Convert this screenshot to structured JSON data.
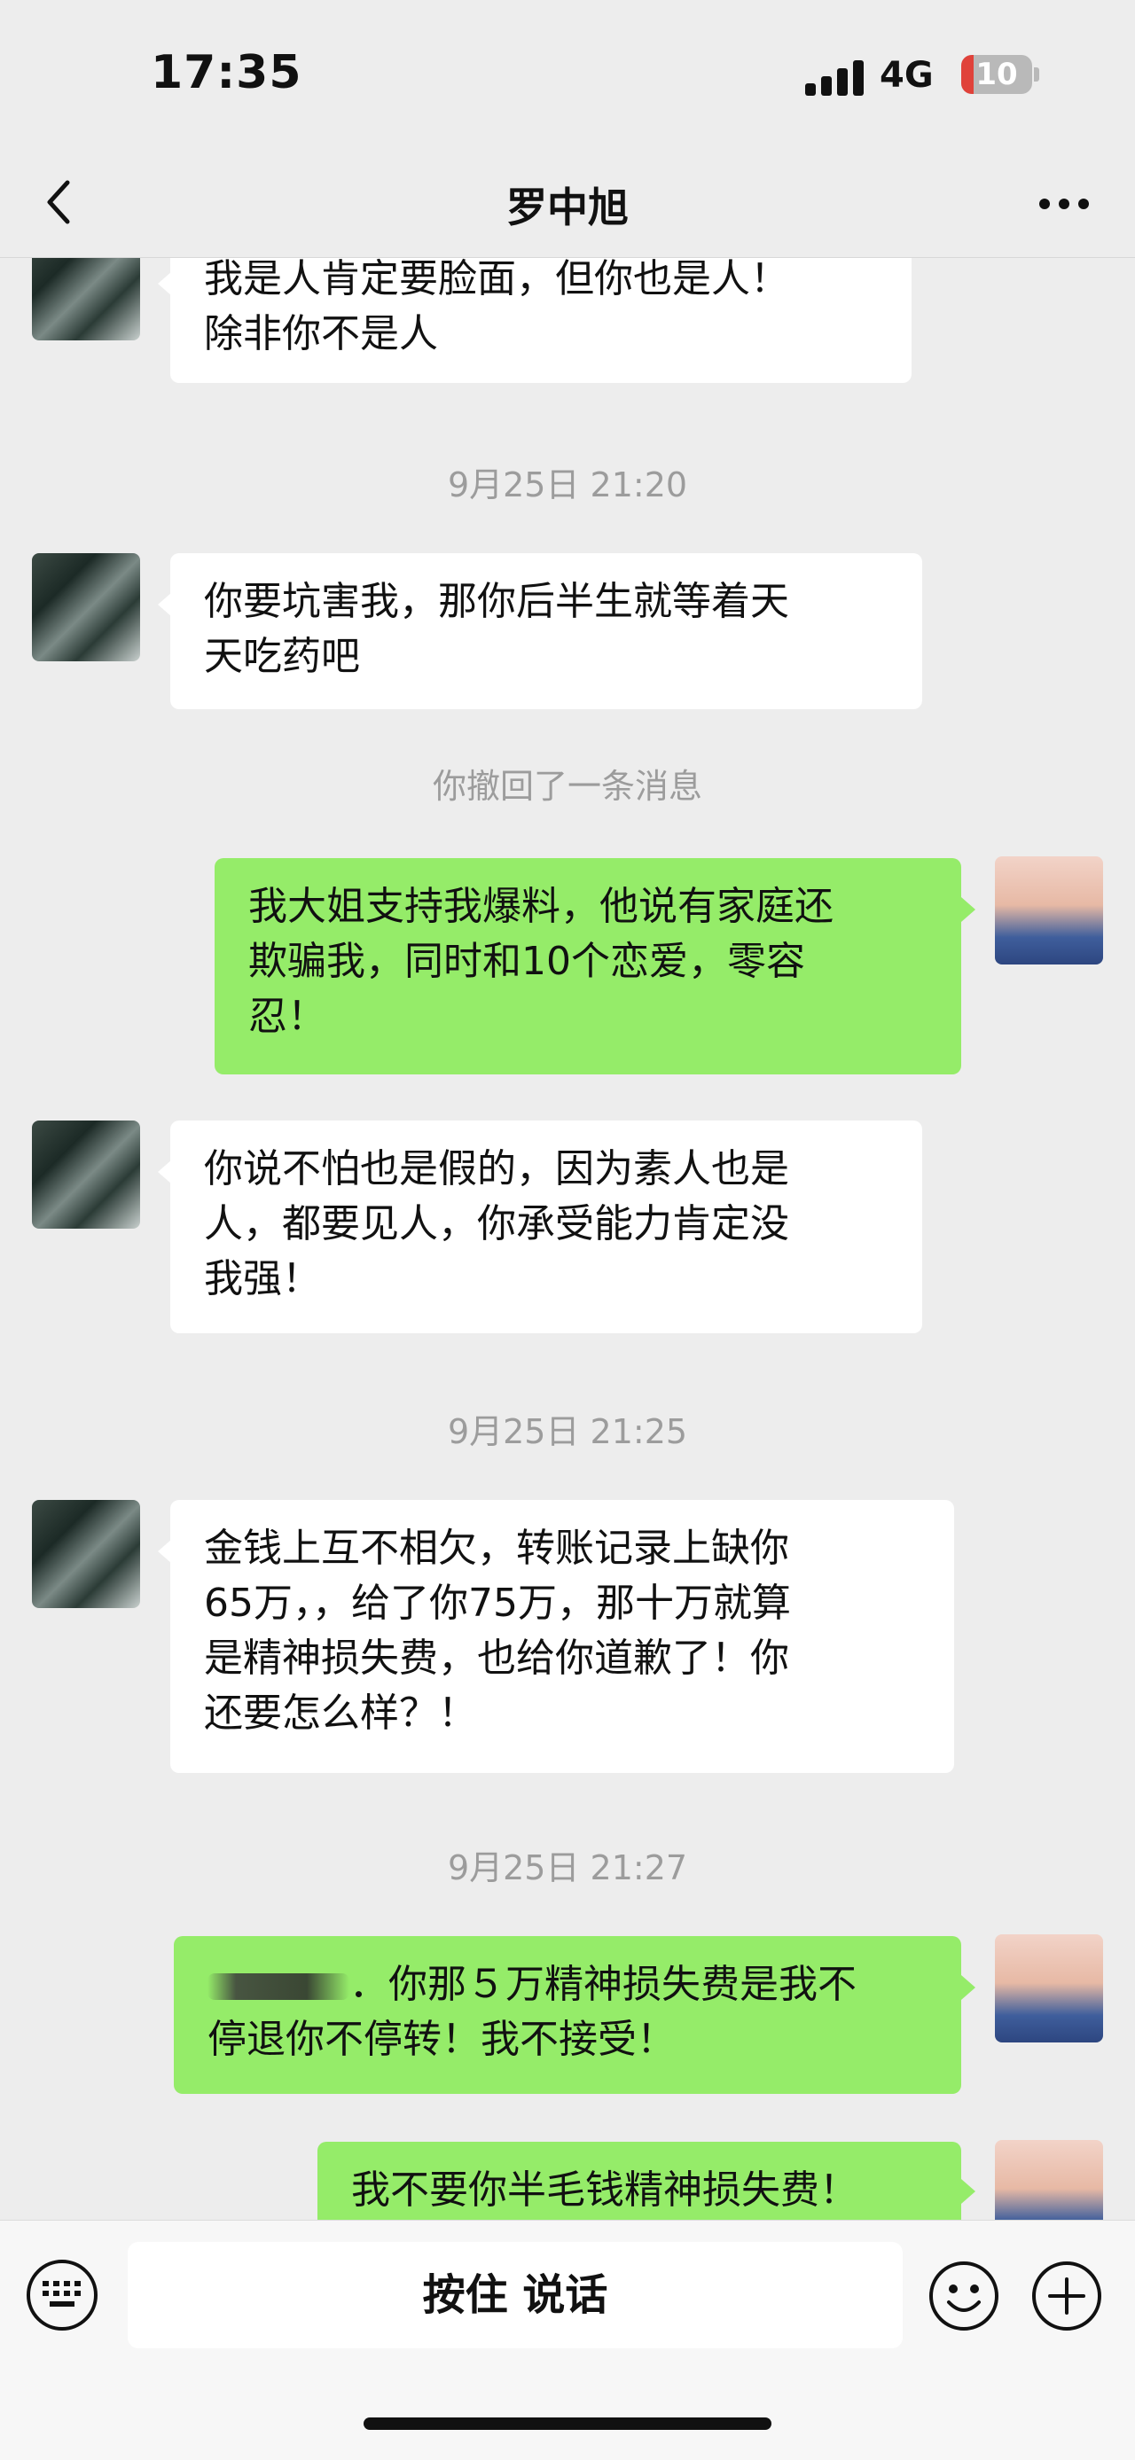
{
  "status_bar": {
    "time": "17:35",
    "network": "4G",
    "battery": "10"
  },
  "header": {
    "title": "罗中旭"
  },
  "messages": {
    "m1": {
      "line1": "我是人肯定要脸面，但你也是人！",
      "line2": "除非你不是人"
    },
    "t1": "9月25日 21:20",
    "m2": {
      "line1": "你要坑害我，那你后半生就等着天",
      "line2": "天吃药吧"
    },
    "recall": "你撤回了一条消息",
    "m3": {
      "line1": "我大姐支持我爆料，他说有家庭还",
      "line2": "欺骗我，同时和10个恋爱，零容",
      "line3": "忍！"
    },
    "m4": {
      "line1": "你说不怕也是假的，因为素人也是",
      "line2": "人，都要见人，你承受能力肯定没",
      "line3": "我强！"
    },
    "t2": "9月25日 21:25",
    "m5": {
      "line1": "金钱上互不相欠，转账记录上缺你",
      "line2": "65万，，给了你75万，那十万就算",
      "line3": "是精神损失费，也给你道歉了！你",
      "line4": "还要怎么样？！"
    },
    "t3": "9月25日 21:27",
    "m6": {
      "line1_tail": "．你那５万精神损失费是我不",
      "line2": "停退你不停转！我不接受！"
    },
    "m7": {
      "line1": "我不要你半毛钱精神损失费！"
    }
  },
  "input_bar": {
    "hold_to_talk": "按住 说话"
  },
  "icons": {
    "back": "chevron-left-icon",
    "more": "more-dots-icon",
    "keyboard": "keyboard-icon",
    "emoji": "emoji-icon",
    "plus": "plus-icon"
  },
  "colors": {
    "background": "#ededed",
    "incoming_bubble": "#ffffff",
    "outgoing_bubble": "#95ec69",
    "timestamp": "#9c9c9c"
  }
}
